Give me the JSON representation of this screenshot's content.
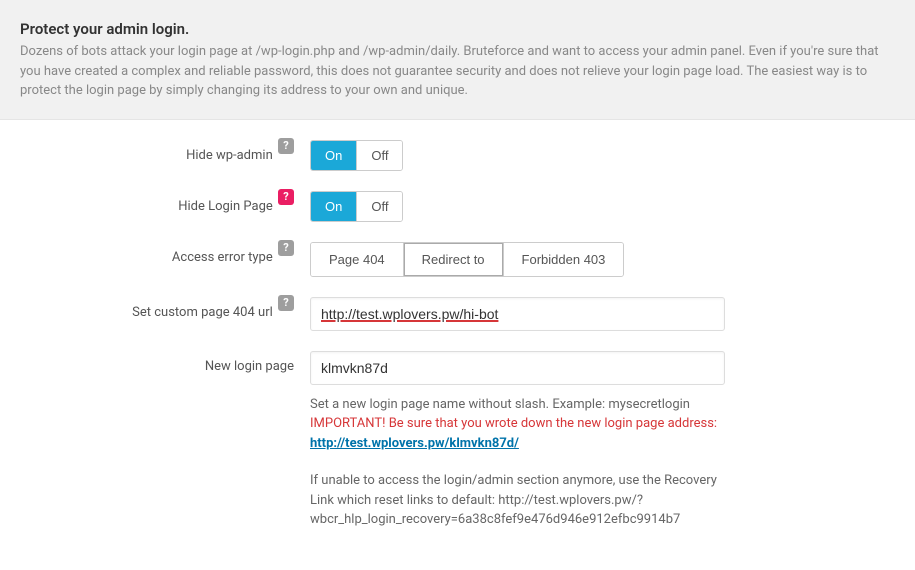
{
  "header": {
    "title": "Protect your admin login.",
    "description": "Dozens of bots attack your login page at /wp-login.php and /wp-admin/daily. Bruteforce and want to access your admin panel. Even if you're sure that you have created a complex and reliable password, this does not guarantee security and does not relieve your login page load. The easiest way is to protect the login page by simply changing its address to your own and unique."
  },
  "fields": {
    "hide_wp_admin": {
      "label": "Hide wp-admin",
      "help_icon": "?",
      "on_label": "On",
      "off_label": "Off"
    },
    "hide_login_page": {
      "label": "Hide Login Page",
      "help_icon": "?",
      "on_label": "On",
      "off_label": "Off"
    },
    "access_error_type": {
      "label": "Access error type",
      "help_icon": "?",
      "options": {
        "page404": "Page 404",
        "redirect": "Redirect to",
        "forbidden": "Forbidden 403"
      }
    },
    "custom_404_url": {
      "label": "Set custom page 404 url",
      "help_icon": "?",
      "value": "http://test.wplovers.pw/hi-bot"
    },
    "new_login_page": {
      "label": "New login page",
      "value": "klmvkn87d",
      "hint1": "Set a new login page name without slash. Example: mysecretlogin",
      "hint2": "IMPORTANT! Be sure that you wrote down the new login page address:",
      "link_text": "http://test.wplovers.pw/klmvkn87d/",
      "hint3": "If unable to access the login/admin section anymore, use the Recovery Link which reset links to default: http://test.wplovers.pw/?wbcr_hlp_login_recovery=6a38c8fef9e476d946e912efbc9914b7"
    }
  }
}
